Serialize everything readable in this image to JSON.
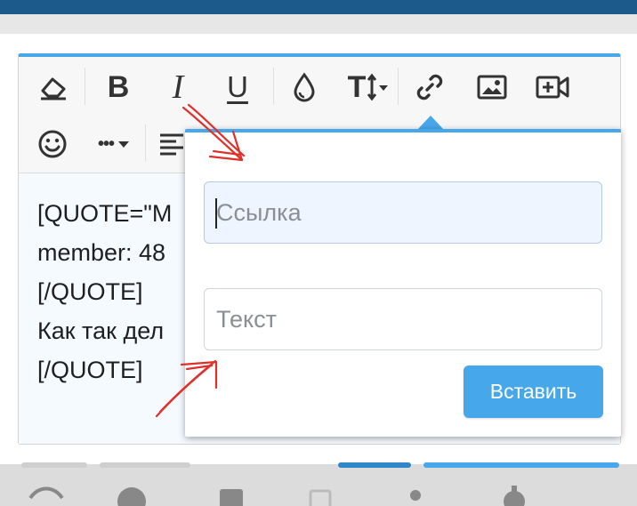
{
  "toolbar": {
    "row1": [
      {
        "name": "eraser-icon"
      },
      {
        "name": "bold-icon",
        "glyph": "B"
      },
      {
        "name": "italic-icon",
        "glyph": "I"
      },
      {
        "name": "underline-icon",
        "glyph": "U"
      },
      {
        "name": "droplet-icon"
      },
      {
        "name": "font-size-icon",
        "glyph": "T"
      },
      {
        "name": "link-icon"
      },
      {
        "name": "image-icon"
      },
      {
        "name": "video-icon"
      }
    ],
    "row2": [
      {
        "name": "emoji-icon"
      },
      {
        "name": "more-options-icon",
        "glyph": "•••"
      },
      {
        "name": "align-icon"
      }
    ]
  },
  "editor": {
    "lines": [
      "[QUOTE=\"M",
      "member: 48",
      "[/QUOTE]",
      "Как так дел",
      "[/QUOTE]"
    ]
  },
  "link_popup": {
    "url_placeholder": "Ссылка",
    "text_placeholder": "Текст",
    "insert_label": "Вставить"
  },
  "colors": {
    "accent": "#47a7eb",
    "annotation": "#e0302a",
    "header": "#1b5a8a"
  }
}
